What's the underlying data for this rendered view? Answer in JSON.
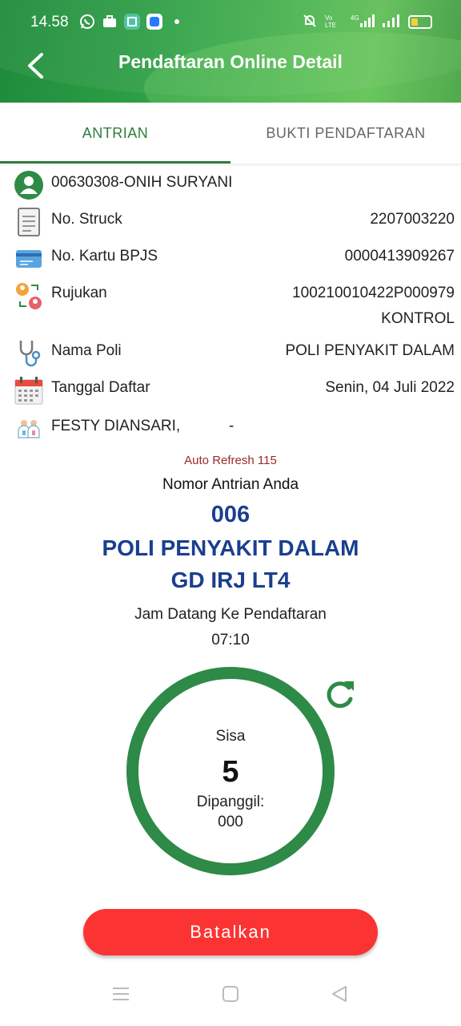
{
  "status_bar": {
    "time": "14.58",
    "left_icons": [
      "whatsapp-icon",
      "briefcase-icon",
      "app-icon",
      "app-icon",
      "dot-icon"
    ],
    "right_icons": [
      "mute-icon",
      "volte-icon",
      "signal-4g-icon",
      "signal-icon",
      "battery-icon"
    ]
  },
  "header": {
    "title": "Pendaftaran Online Detail",
    "back_icon": "back-arrow-icon"
  },
  "tabs": [
    {
      "label": "ANTRIAN",
      "active": true
    },
    {
      "label": "BUKTI PENDAFTARAN",
      "active": false
    }
  ],
  "patient": {
    "name": "00630308-ONIH SURYANI",
    "icon": "user-avatar-icon"
  },
  "details": {
    "struck": {
      "label": "No. Struck",
      "value": "2207003220"
    },
    "bpjs": {
      "label": "No. Kartu BPJS",
      "value": "0000413909267"
    },
    "rujukan": {
      "label": "Rujukan",
      "value": "100210010422P000979",
      "value2": "KONTROL"
    },
    "poli": {
      "label": "Nama Poli",
      "value": "POLI PENYAKIT DALAM"
    },
    "tanggal": {
      "label": "Tanggal Daftar",
      "value": "Senin, 04 Juli 2022"
    },
    "doctor": {
      "label": "FESTY DIANSARI,",
      "value": "-"
    }
  },
  "queue": {
    "auto_refresh": "Auto Refresh 115",
    "nomor_label": "Nomor Antrian Anda",
    "number": "006",
    "poli": "POLI PENYAKIT DALAM",
    "location": "GD IRJ LT4",
    "jam_label": "Jam Datang Ke Pendaftaran",
    "jam_value": "07:10",
    "sisa_label": "Sisa",
    "sisa_value": "5",
    "dipanggil_label": "Dipanggil:",
    "dipanggil_value": "000",
    "refresh_icon": "refresh-icon"
  },
  "actions": {
    "cancel_label": "Batalkan"
  },
  "colors": {
    "header_green": "#2fa046",
    "tab_active": "#2f7d3c",
    "queue_blue": "#1a3f8f",
    "circle_green": "#2e8a47",
    "cancel_red": "#fb3333",
    "auto_refresh": "#9b2a2a"
  },
  "nav": [
    "menu-icon",
    "home-icon",
    "back-triangle-icon"
  ]
}
